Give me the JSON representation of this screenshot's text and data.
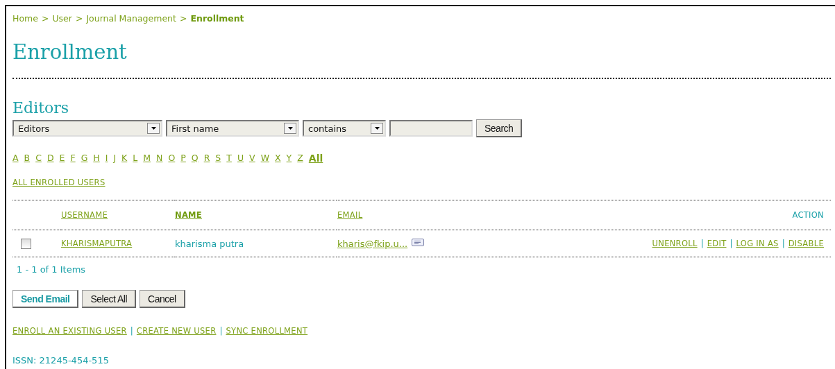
{
  "breadcrumb": [
    {
      "label": "Home",
      "current": false
    },
    {
      "label": "User",
      "current": false
    },
    {
      "label": "Journal Management",
      "current": false
    },
    {
      "label": "Enrollment",
      "current": true
    }
  ],
  "breadcrumb_separator": ">",
  "title": "Enrollment",
  "section_title": "Editors",
  "filters": {
    "role": "Editors",
    "field": "First name",
    "match": "contains",
    "search_button": "Search"
  },
  "letters": [
    {
      "label": "A",
      "selected": false
    },
    {
      "label": "B",
      "selected": false
    },
    {
      "label": "C",
      "selected": false
    },
    {
      "label": "D",
      "selected": false
    },
    {
      "label": "E",
      "selected": false
    },
    {
      "label": "F",
      "selected": false
    },
    {
      "label": "G",
      "selected": false
    },
    {
      "label": "H",
      "selected": false
    },
    {
      "label": "I",
      "selected": false
    },
    {
      "label": "J",
      "selected": false
    },
    {
      "label": "K",
      "selected": false
    },
    {
      "label": "L",
      "selected": false
    },
    {
      "label": "M",
      "selected": false
    },
    {
      "label": "N",
      "selected": false
    },
    {
      "label": "O",
      "selected": false
    },
    {
      "label": "P",
      "selected": false
    },
    {
      "label": "Q",
      "selected": false
    },
    {
      "label": "R",
      "selected": false
    },
    {
      "label": "S",
      "selected": false
    },
    {
      "label": "T",
      "selected": false
    },
    {
      "label": "U",
      "selected": false
    },
    {
      "label": "V",
      "selected": false
    },
    {
      "label": "W",
      "selected": false
    },
    {
      "label": "X",
      "selected": false
    },
    {
      "label": "Y",
      "selected": false
    },
    {
      "label": "Z",
      "selected": false
    },
    {
      "label": "All",
      "selected": true
    }
  ],
  "all_enrolled_link": "ALL ENROLLED USERS",
  "table": {
    "columns": [
      {
        "label": "USERNAME",
        "kind": "link",
        "selected": false
      },
      {
        "label": "NAME",
        "kind": "link",
        "selected": true
      },
      {
        "label": "EMAIL",
        "kind": "link",
        "selected": false
      },
      {
        "label": "ACTION",
        "kind": "text",
        "selected": false
      }
    ],
    "rows": [
      {
        "checked": false,
        "username": "KHARISMAPUTRA",
        "name": "kharisma putra",
        "email": "kharis@fkip.u...",
        "actions": [
          "UNENROLL",
          "EDIT",
          "LOG IN AS",
          "DISABLE"
        ]
      }
    ]
  },
  "action_separator": "|",
  "pagination": "1 - 1 of 1 Items",
  "buttons": [
    {
      "label": "Send Email",
      "kind": "primary"
    },
    {
      "label": "Select All",
      "kind": "default"
    },
    {
      "label": "Cancel",
      "kind": "default"
    }
  ],
  "footer_links": [
    "ENROLL AN EXISTING USER",
    "CREATE NEW USER",
    "SYNC ENROLLMENT"
  ],
  "issn": "ISSN: 21245-454-515"
}
